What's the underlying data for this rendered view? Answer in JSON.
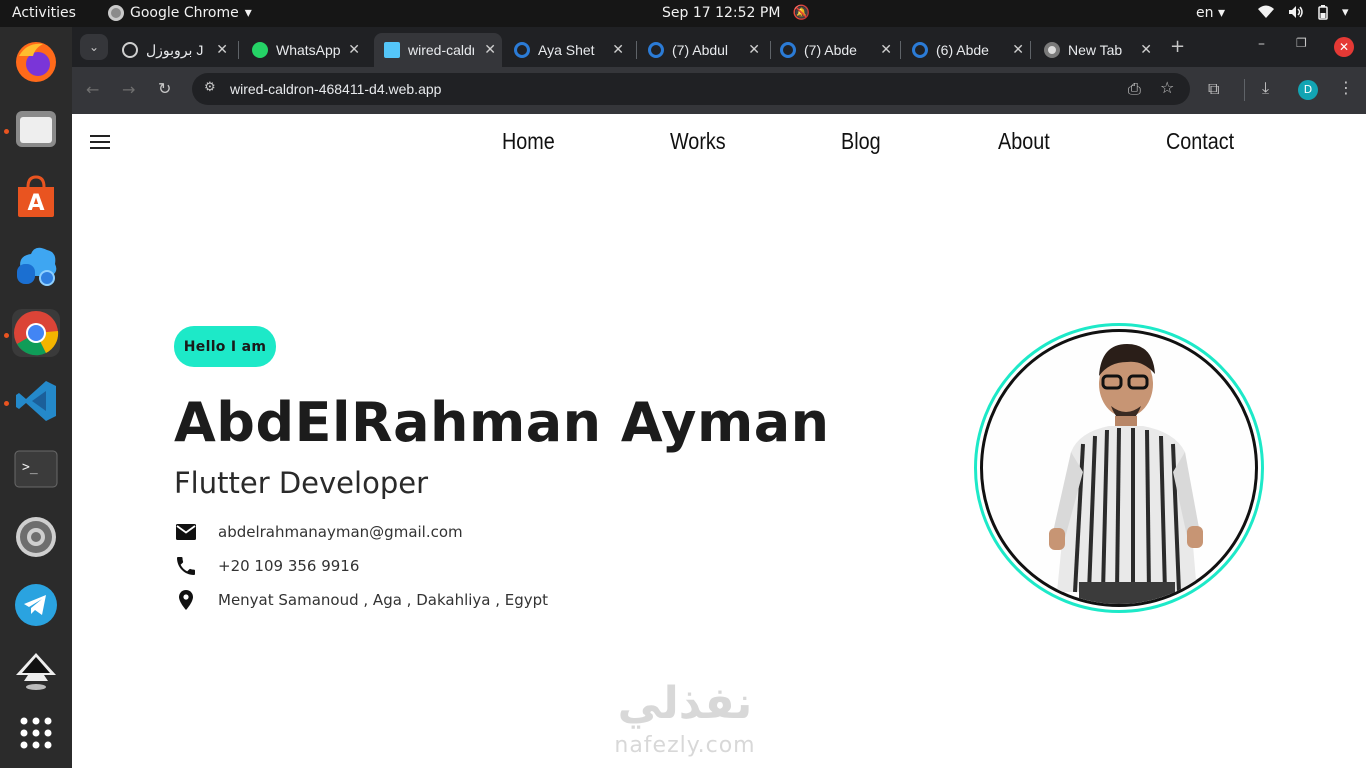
{
  "topbar": {
    "activities": "Activities",
    "app_name": "Google Chrome",
    "clock": "Sep 17  12:52 PM",
    "lang": "en",
    "icons": [
      "wifi-icon",
      "volume-icon",
      "battery-icon",
      "power-icon"
    ]
  },
  "dock": {
    "items": [
      "firefox",
      "files",
      "app-center",
      "azure-data-studio",
      "chrome",
      "vscode",
      "terminal",
      "settings",
      "telegram",
      "inkscape",
      "app-grid"
    ]
  },
  "browser": {
    "tabs": [
      {
        "title": "بروبوزل J",
        "icon": "openai-icon"
      },
      {
        "title": "WhatsApp",
        "icon": "whatsapp-icon"
      },
      {
        "title": "wired-caldron",
        "icon": "flutter-icon"
      },
      {
        "title": "Aya Shet",
        "icon": "upwork-icon"
      },
      {
        "title": "(7) Abdul",
        "icon": "upwork-icon"
      },
      {
        "title": "(7) Abde",
        "icon": "upwork-icon"
      },
      {
        "title": "(6) Abde",
        "icon": "upwork-icon"
      },
      {
        "title": "New Tab",
        "icon": "chrome-icon"
      }
    ],
    "url": "wired-caldron-468411-d4.web.app",
    "profile_initial": "D"
  },
  "page": {
    "nav": [
      "Home",
      "Works",
      "Blog",
      "About",
      "Contact"
    ],
    "hello": "Hello I am",
    "name": "AbdElRahman Ayman",
    "role": "Flutter Developer",
    "contact": {
      "email": "abdelrahmanayman@gmail.com",
      "phone": "+20 109 356 9916",
      "address": "Menyat Samanoud , Aga , Dakahliya , Egypt"
    },
    "watermark_ar": "نفذلي",
    "watermark_en": "nafezly.com"
  },
  "colors": {
    "accent": "#1de9c8",
    "text": "#1c1c1c",
    "chrome_dark": "#202124"
  }
}
